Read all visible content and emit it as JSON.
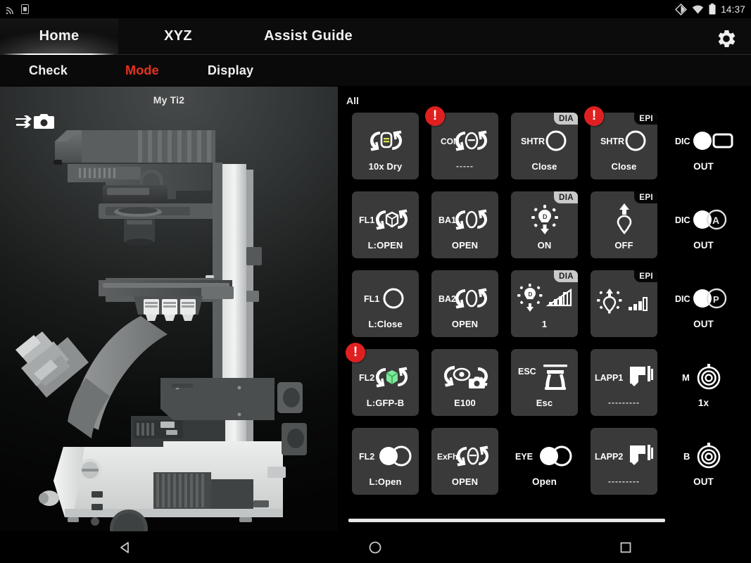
{
  "statusbar": {
    "time": "14:37",
    "icons": [
      "cast-icon",
      "sim-card-icon",
      "dnd-icon",
      "wifi-icon",
      "battery-icon"
    ]
  },
  "topnav": {
    "tabs": [
      {
        "label": "Home",
        "active": true
      },
      {
        "label": "XYZ",
        "active": false
      },
      {
        "label": "Assist Guide",
        "active": false
      }
    ],
    "settings_icon": "gear-icon"
  },
  "subnav": {
    "tabs": [
      {
        "label": "Check",
        "active": false
      },
      {
        "label": "Mode",
        "active": true
      },
      {
        "label": "Display",
        "active": false
      }
    ],
    "active_color": "#e8321e"
  },
  "viewport": {
    "title": "My Ti2",
    "camera_swap_icon": "camera-swap-icon",
    "model": "nikon-ti2-inverted-microscope"
  },
  "panel": {
    "title": "All",
    "tiles": [
      {
        "id": "nosepiece",
        "icon": "nosepiece-rotate-icon",
        "prefix": "",
        "label": "10x Dry",
        "badge": null,
        "alert": false,
        "card": true
      },
      {
        "id": "condenser",
        "icon": "condenser-rotate-icon",
        "prefix": "CON",
        "label": "-----",
        "badge": null,
        "alert": true,
        "card": true
      },
      {
        "id": "dia-shutter",
        "icon": "shutter-circle-icon",
        "prefix": "SHTR",
        "label": "Close",
        "badge": "DIA",
        "alert": false,
        "card": true
      },
      {
        "id": "epi-shutter",
        "icon": "shutter-circle-icon",
        "prefix": "SHTR",
        "label": "Close",
        "badge": "EPI",
        "alert": true,
        "card": true
      },
      {
        "id": "dic-prism-out",
        "icon": "dic-slider-icon",
        "prefix": "DIC",
        "label": "OUT",
        "badge": null,
        "alert": false,
        "card": false
      },
      {
        "id": "fl1-turret",
        "icon": "filter-cube-rotate-icon",
        "prefix": "FL1",
        "label": "L:OPEN",
        "badge": null,
        "alert": false,
        "card": true
      },
      {
        "id": "ba1-barrier",
        "icon": "barrier-rotate-icon",
        "prefix": "BA1",
        "label": "OPEN",
        "badge": null,
        "alert": false,
        "card": true
      },
      {
        "id": "dia-lamp",
        "icon": "dia-lamp-icon",
        "prefix": "",
        "label": "ON",
        "badge": "DIA",
        "alert": false,
        "card": true
      },
      {
        "id": "epi-lamp",
        "icon": "epi-lamp-icon",
        "prefix": "",
        "label": "OFF",
        "badge": "EPI",
        "alert": false,
        "card": true
      },
      {
        "id": "dic-analyzer-out",
        "icon": "dic-analyzer-icon",
        "prefix": "DIC",
        "label": "OUT",
        "badge": null,
        "alert": false,
        "card": false
      },
      {
        "id": "fl1-shutter",
        "icon": "open-circle-icon",
        "prefix": "FL1",
        "label": "L:Close",
        "badge": null,
        "alert": false,
        "card": true
      },
      {
        "id": "ba2-barrier",
        "icon": "barrier-rotate-icon",
        "prefix": "BA2",
        "label": "OPEN",
        "badge": null,
        "alert": false,
        "card": true
      },
      {
        "id": "dia-intensity",
        "icon": "dia-intensity-icon",
        "prefix": "",
        "label": "1",
        "badge": "DIA",
        "alert": false,
        "card": true
      },
      {
        "id": "epi-intensity",
        "icon": "epi-intensity-icon",
        "prefix": "",
        "label": "",
        "badge": "EPI",
        "alert": false,
        "card": true
      },
      {
        "id": "dic-polarizer-out",
        "icon": "dic-polarizer-icon",
        "prefix": "DIC",
        "label": "OUT",
        "badge": null,
        "alert": false,
        "card": false
      },
      {
        "id": "fl2-turret",
        "icon": "filter-cube-green-icon",
        "prefix": "FL2",
        "label": "L:GFP-B",
        "badge": null,
        "alert": true,
        "card": true
      },
      {
        "id": "eyepiece-camera-port",
        "icon": "eye-camera-rotate-icon",
        "prefix": "",
        "label": "E100",
        "badge": null,
        "alert": false,
        "card": true
      },
      {
        "id": "esc-stage",
        "icon": "esc-stage-icon",
        "prefix": "ESC",
        "label": "Esc",
        "badge": null,
        "alert": false,
        "card": true
      },
      {
        "id": "lapp1",
        "icon": "lapp-icon",
        "prefix": "LAPP1",
        "label": "---------",
        "badge": null,
        "alert": false,
        "card": true
      },
      {
        "id": "magnifier",
        "icon": "lens-ring-icon",
        "prefix": "M",
        "label": "1x",
        "badge": null,
        "alert": false,
        "card": false
      },
      {
        "id": "fl2-shutter",
        "icon": "toggle-pair-icon",
        "prefix": "FL2",
        "label": "L:Open",
        "badge": null,
        "alert": false,
        "card": true
      },
      {
        "id": "exfilter",
        "icon": "exfilter-rotate-icon",
        "prefix": "ExFh",
        "label": "OPEN",
        "badge": null,
        "alert": false,
        "card": true
      },
      {
        "id": "eye-shutter",
        "icon": "toggle-pair-icon",
        "prefix": "EYE",
        "label": "Open",
        "badge": null,
        "alert": false,
        "card": false
      },
      {
        "id": "lapp2",
        "icon": "lapp-icon",
        "prefix": "LAPP2",
        "label": "---------",
        "badge": null,
        "alert": false,
        "card": true
      },
      {
        "id": "bertrand",
        "icon": "lens-ring-icon",
        "prefix": "B",
        "label": "OUT",
        "badge": null,
        "alert": false,
        "card": false
      }
    ],
    "scrollbar_visible": true
  },
  "navbar": {
    "buttons": [
      {
        "name": "back-button",
        "icon": "triangle-left-icon"
      },
      {
        "name": "home-button",
        "icon": "circle-icon"
      },
      {
        "name": "recents-button",
        "icon": "square-icon"
      }
    ]
  },
  "colors": {
    "tile_bg": "#3a3a3a",
    "panel_bg": "#000000",
    "alert_red": "#e02020",
    "mode_red": "#e8321e",
    "text": "#ffffff"
  }
}
